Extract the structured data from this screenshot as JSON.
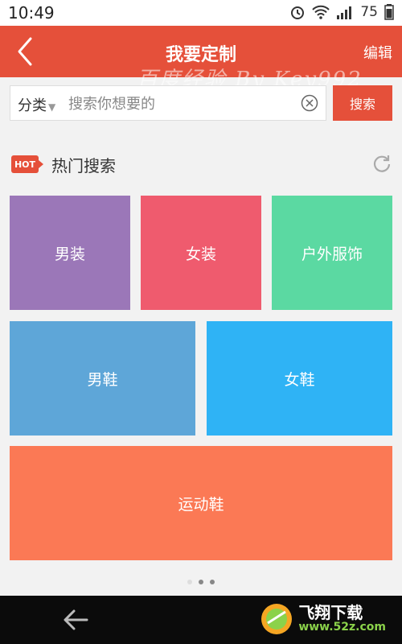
{
  "status_bar": {
    "time": "10:49",
    "battery": "75"
  },
  "header": {
    "title": "我要定制",
    "edit_label": "编辑",
    "watermark": "百度经验 By Key992"
  },
  "search": {
    "category": "分类",
    "placeholder": "搜索你想要的",
    "button_label": "搜索"
  },
  "hot": {
    "badge": "HOT",
    "title": "热门搜索"
  },
  "tiles": [
    {
      "label": "男装",
      "color": "#9b77b8"
    },
    {
      "label": "女装",
      "color": "#ef5b6e"
    },
    {
      "label": "户外服饰",
      "color": "#5bd9a2"
    },
    {
      "label": "男鞋",
      "color": "#5ea6d8"
    },
    {
      "label": "女鞋",
      "color": "#2fb3f5"
    },
    {
      "label": "运动鞋",
      "color": "#fb7955"
    }
  ],
  "pagination": {
    "pages": 3,
    "active": 0
  },
  "branding": {
    "name": "飞翔下载",
    "url": "www.52z.com"
  },
  "colors": {
    "accent": "#e5503a"
  }
}
